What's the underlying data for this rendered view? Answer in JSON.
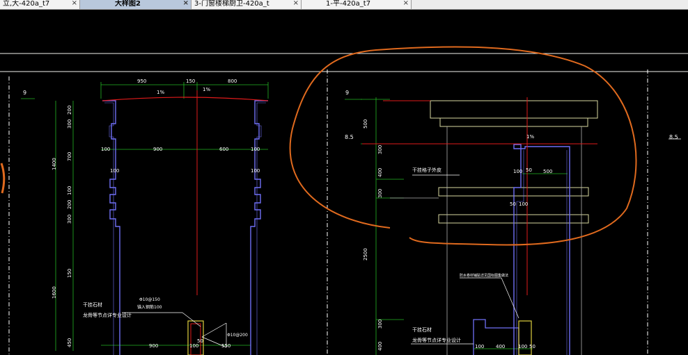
{
  "tabs": [
    {
      "label": "立,大-420a_t7",
      "active": false
    },
    {
      "label": "大样图2",
      "active": true
    },
    {
      "label": "3-门窗楼梯厨卫-420a_t",
      "active": false
    },
    {
      "label": "1-平-420a_t7",
      "active": false
    }
  ],
  "close_glyph": "×",
  "drawing": {
    "left": {
      "level_mark": "9",
      "top_dims": [
        "950",
        "150",
        "800"
      ],
      "slope_left": "1%",
      "slope_right": "1%",
      "left_dims": [
        "200",
        "300",
        "1400",
        "700",
        "100",
        "200",
        "300",
        "150",
        "1600",
        "450"
      ],
      "width_dims": [
        "100",
        "100",
        "900",
        "600",
        "100",
        "100"
      ],
      "notch_dims": [
        "100",
        "100"
      ],
      "note_line1": "干挂石材",
      "note_line2": "龙骨等节点详专业设计",
      "rebar_note1": "Φ10@150",
      "rebar_note2": "锚入钢筋100",
      "rebar_note3": "Φ10@200",
      "bottom_dims": [
        "900",
        "100",
        "50",
        "550"
      ]
    },
    "right": {
      "level_mark": "9",
      "level_mark_2": "8.5",
      "level_mark_far": "8.5",
      "slope": "1%",
      "left_dims": [
        "500",
        "300",
        "400",
        "300",
        "2500",
        "300",
        "400"
      ],
      "note": "干挂格子外皮",
      "dims_mid": [
        "100",
        "50",
        "500",
        "50",
        "100"
      ],
      "note_small": "防水卷材铺贴详见国标图集做法",
      "note_line1": "干挂石材",
      "note_line2": "龙骨等节点详专业设计",
      "bottom_dims": [
        "100",
        "400",
        "100",
        "50"
      ]
    }
  },
  "colors": {
    "background": "#000000",
    "outline": "#6f6ff5",
    "dimension": "#23b723",
    "axis": "#e01a1a",
    "frame": "#f2f2ee",
    "annotation": "#e06a1e",
    "detail": "#d8d8a0",
    "text": "#ffffff"
  }
}
